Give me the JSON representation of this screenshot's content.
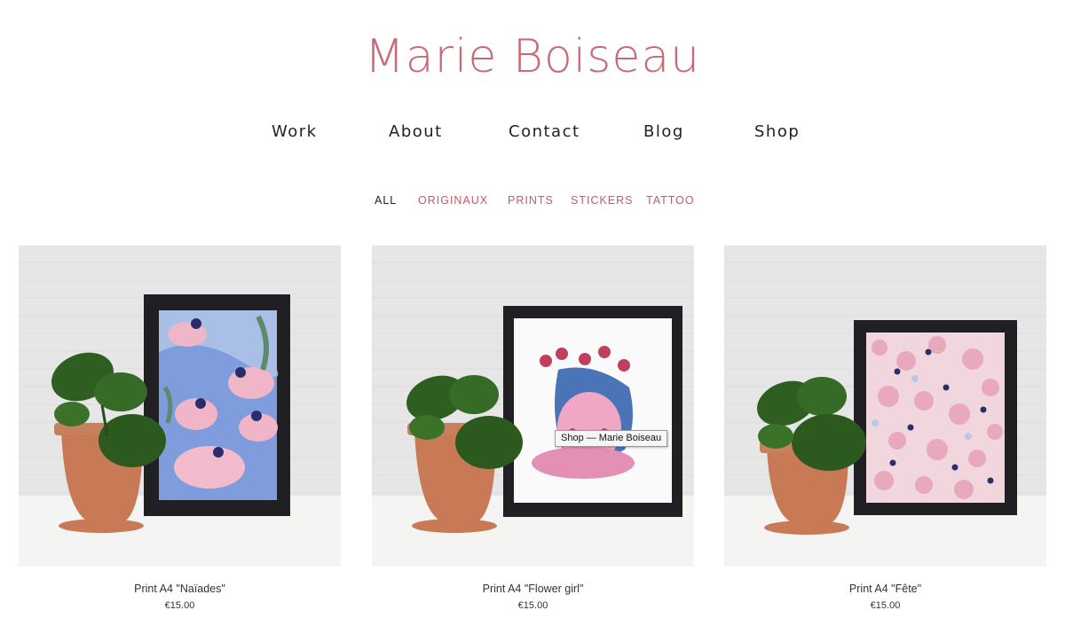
{
  "header": {
    "site_title": "Marie Boiseau"
  },
  "nav": {
    "items": [
      {
        "label": "Work"
      },
      {
        "label": "About"
      },
      {
        "label": "Contact"
      },
      {
        "label": "Blog"
      },
      {
        "label": "Shop"
      }
    ]
  },
  "filters": {
    "items": [
      {
        "label": "ALL",
        "active": true
      },
      {
        "label": "ORIGINAUX",
        "active": false
      },
      {
        "label": "PRINTS",
        "active": false
      },
      {
        "label": "STICKERS",
        "active": false
      },
      {
        "label": "TATTOO",
        "active": false
      }
    ]
  },
  "products": [
    {
      "name": "Print A4 \"Naïades\"",
      "price": "€15.00",
      "artwork": "blue-water-pink-figures"
    },
    {
      "name": "Print A4 \"Flower girl\"",
      "price": "€15.00",
      "artwork": "pink-flower-girl"
    },
    {
      "name": "Print A4 \"Fête\"",
      "price": "€15.00",
      "artwork": "pink-crowd-pattern"
    }
  ],
  "tooltip": {
    "text": "Shop — Marie Boiseau"
  },
  "colors": {
    "accent": "#c96b76",
    "filter_link": "#c25b68",
    "frame": "#1f1f24",
    "pot": "#c77a55",
    "leaf": "#2f5e21"
  }
}
